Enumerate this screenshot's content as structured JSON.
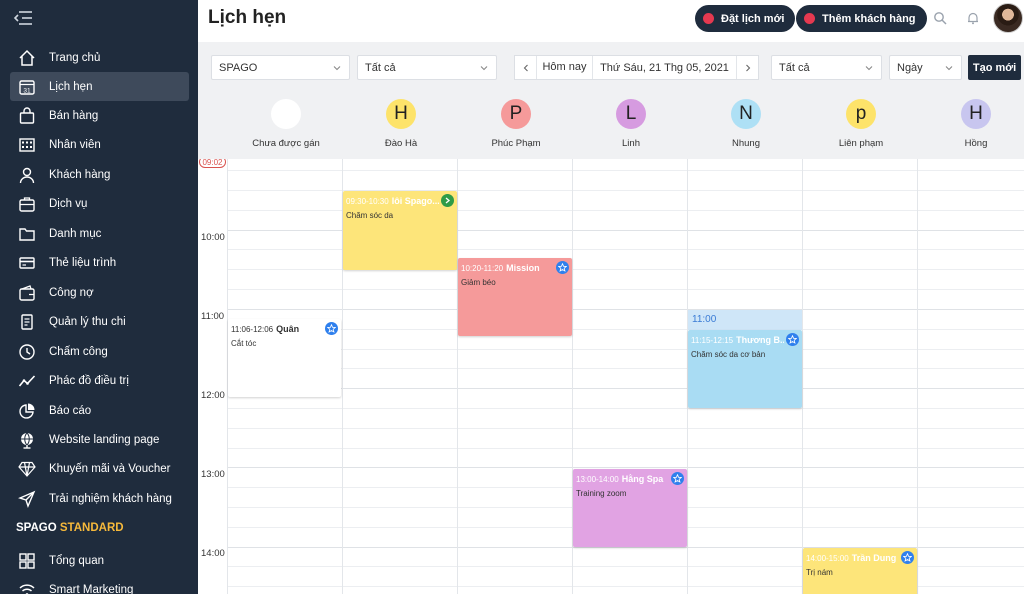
{
  "sidebar": {
    "items": [
      {
        "label": "Trang chủ",
        "icon": "home-icon"
      },
      {
        "label": "Lịch hẹn",
        "icon": "calendar-icon",
        "day": "31"
      },
      {
        "label": "Bán hàng",
        "icon": "shopping-bag-icon"
      },
      {
        "label": "Nhân viên",
        "icon": "staff-grid-icon"
      },
      {
        "label": "Khách hàng",
        "icon": "user-icon"
      },
      {
        "label": "Dịch vụ",
        "icon": "briefcase-icon"
      },
      {
        "label": "Danh mục",
        "icon": "folder-icon"
      },
      {
        "label": "Thẻ liệu trình",
        "icon": "card-icon"
      },
      {
        "label": "Công nợ",
        "icon": "wallet-icon"
      },
      {
        "label": "Quản lý thu chi",
        "icon": "receipt-icon"
      },
      {
        "label": "Chấm công",
        "icon": "clock-icon"
      },
      {
        "label": "Phác đồ điều trị",
        "icon": "trend-icon"
      },
      {
        "label": "Báo cáo",
        "icon": "pie-chart-icon"
      },
      {
        "label": "Website landing page",
        "icon": "globe-icon"
      },
      {
        "label": "Khuyến mãi và Voucher",
        "icon": "diamond-icon"
      },
      {
        "label": "Trải nghiệm khách hàng",
        "icon": "send-icon"
      }
    ],
    "brand": {
      "name": "SPAGO",
      "tier": "STANDARD"
    },
    "bottom_items": [
      {
        "label": "Tổng quan",
        "icon": "dashboard-icon"
      },
      {
        "label": "Smart Marketing",
        "icon": "wifi-icon"
      }
    ]
  },
  "header": {
    "title": "Lịch hẹn",
    "book_button": "Đặt lịch mới",
    "add_customer_button": "Thêm khách hàng"
  },
  "toolbar": {
    "branch": "SPAGO",
    "filter1": "Tất cả",
    "today": "Hôm nay",
    "date": "Thứ Sáu, 21 Thg 05, 2021",
    "filter2": "Tất cả",
    "view": "Ngày",
    "create": "Tạo mới"
  },
  "staff": [
    {
      "initial": "",
      "name": "Chưa được gán",
      "color": "#ffffff"
    },
    {
      "initial": "H",
      "name": "Đào Hà",
      "color": "#fde36a"
    },
    {
      "initial": "P",
      "name": "Phúc Phạm",
      "color": "#f59a9a"
    },
    {
      "initial": "L",
      "name": "Linh",
      "color": "#d69be0"
    },
    {
      "initial": "N",
      "name": "Nhung",
      "color": "#aee0f5"
    },
    {
      "initial": "p",
      "name": "Liên phạm",
      "color": "#fde36a"
    },
    {
      "initial": "H",
      "name": "Hồng",
      "color": "#c8c6ef"
    }
  ],
  "calendar": {
    "now": "09:02",
    "hours": [
      "10:00",
      "11:00",
      "12:00",
      "13:00",
      "14:00"
    ],
    "highlight": "11:00",
    "appointments": [
      {
        "time": "09:30-10:30",
        "name": "Iôi Spago...",
        "service": "Chăm sóc da",
        "color": "#fde57a",
        "badge": "arrow"
      },
      {
        "time": "10:20-11:20",
        "name": "Mission",
        "service": "Giảm béo",
        "color": "#f59a9a",
        "badge": "star"
      },
      {
        "time": "11:06-12:06",
        "name": "Quân",
        "service": "Cắt tóc",
        "color": "#ffffff",
        "badge": "star"
      },
      {
        "time": "11:15-12:15",
        "name": "Thương B...",
        "service": "Chăm sóc da cơ bản",
        "color": "#a9dcf3",
        "badge": "star"
      },
      {
        "time": "13:00-14:00",
        "name": "Hằng Spa",
        "service": "Training zoom",
        "color": "#e1a3e3",
        "badge": "star"
      },
      {
        "time": "14:00-15:00",
        "name": "Trần Dung",
        "service": "Trị nám",
        "color": "#fde57a",
        "badge": "star"
      }
    ]
  },
  "colors": {
    "sidebar": "#1f2c3d",
    "accent": "#e53950",
    "star_badge": "#2f80ed",
    "arrow_badge": "#2e9b47"
  }
}
